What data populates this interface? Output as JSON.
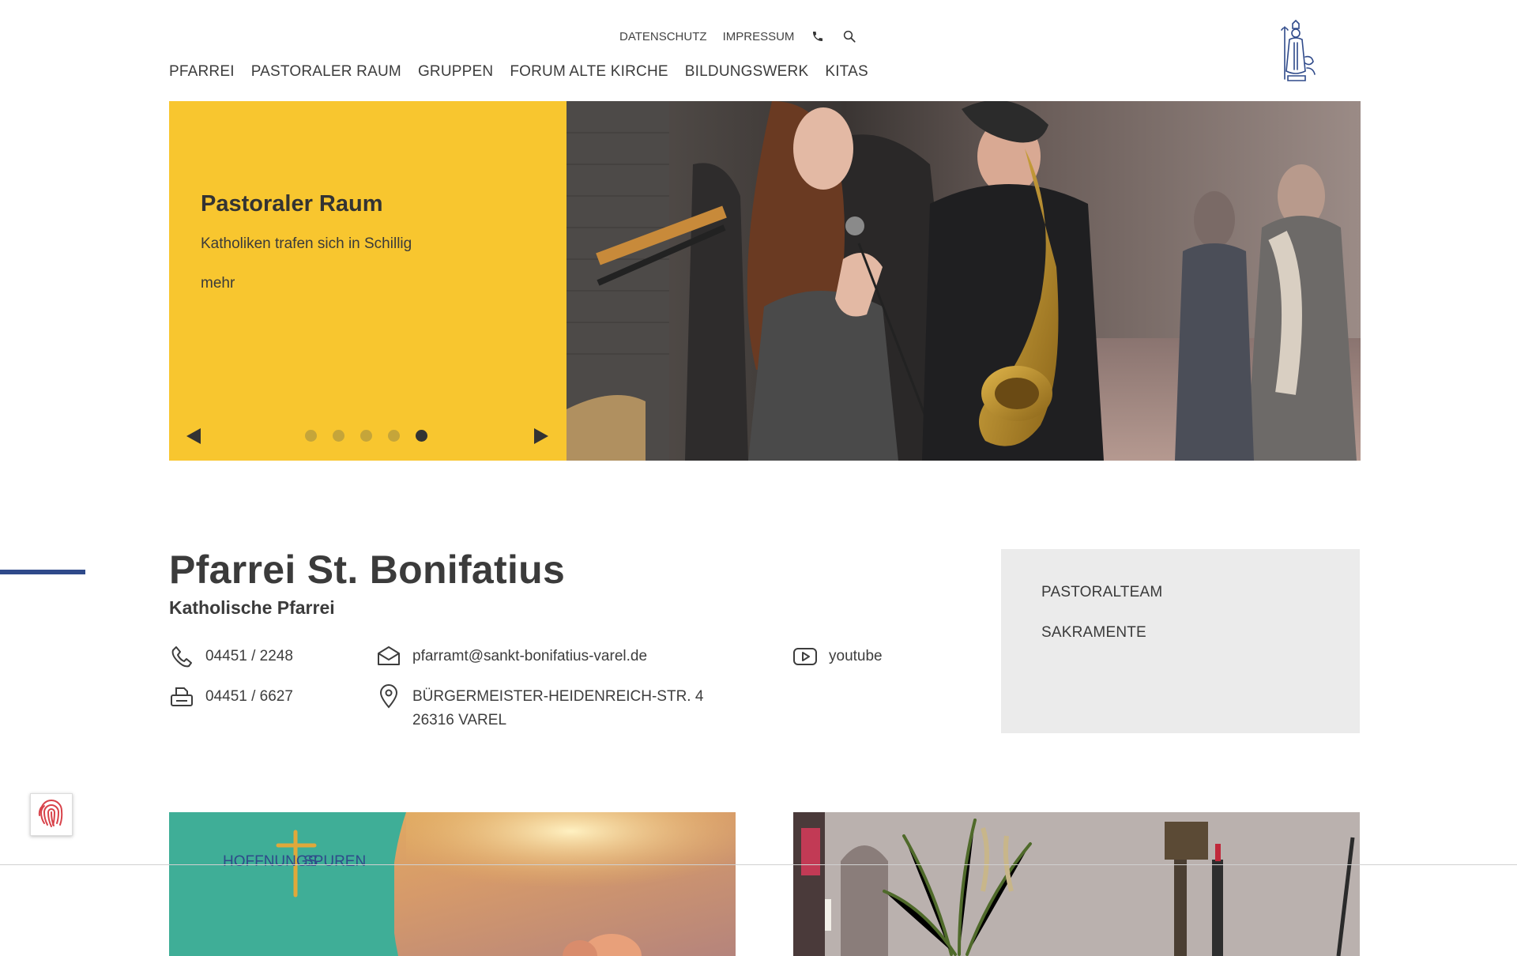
{
  "header": {
    "top_links": [
      {
        "label": "DATENSCHUTZ"
      },
      {
        "label": "IMPRESSUM"
      }
    ],
    "icons": [
      "phone-icon",
      "search-icon"
    ],
    "nav": [
      {
        "label": "PFARREI"
      },
      {
        "label": "PASTORALER RAUM"
      },
      {
        "label": "GRUPPEN"
      },
      {
        "label": "FORUM ALTE KIRCHE"
      },
      {
        "label": "BILDUNGSWERK"
      },
      {
        "label": "KITAS"
      }
    ],
    "logo": "saint-figure-logo"
  },
  "hero": {
    "title": "Pastoraler Raum",
    "subtitle": "Katholiken trafen sich in Schillig",
    "more_label": "mehr",
    "slide_count": 5,
    "active_slide": 5,
    "panel_color": "#f8c62f"
  },
  "parish": {
    "title": "Pfarrei St. Bonifatius",
    "subtitle": "Katholische Pfarrei",
    "phone": "04451 / 2248",
    "fax": "04451 / 6627",
    "email": "pfarramt@sankt-bonifatius-varel.de",
    "address_line1": "BÜRGERMEISTER-HEIDENREICH-STR. 4",
    "address_line2": "26316 VAREL",
    "youtube": "youtube"
  },
  "sidebox": {
    "links": [
      {
        "label": "PASTORALTEAM"
      },
      {
        "label": "SAKRAMENTE"
      }
    ]
  },
  "teasers": [
    {
      "logo_text_left": "HOFFNUNGS",
      "logo_text_right": "SPUREN"
    },
    {
      "image": "church-altar-photo"
    }
  ],
  "colors": {
    "accent_blue": "#2f4a8a",
    "hero_yellow": "#f8c62f",
    "teaser_green": "#3fae97",
    "sidebox_gray": "#ebebeb"
  }
}
